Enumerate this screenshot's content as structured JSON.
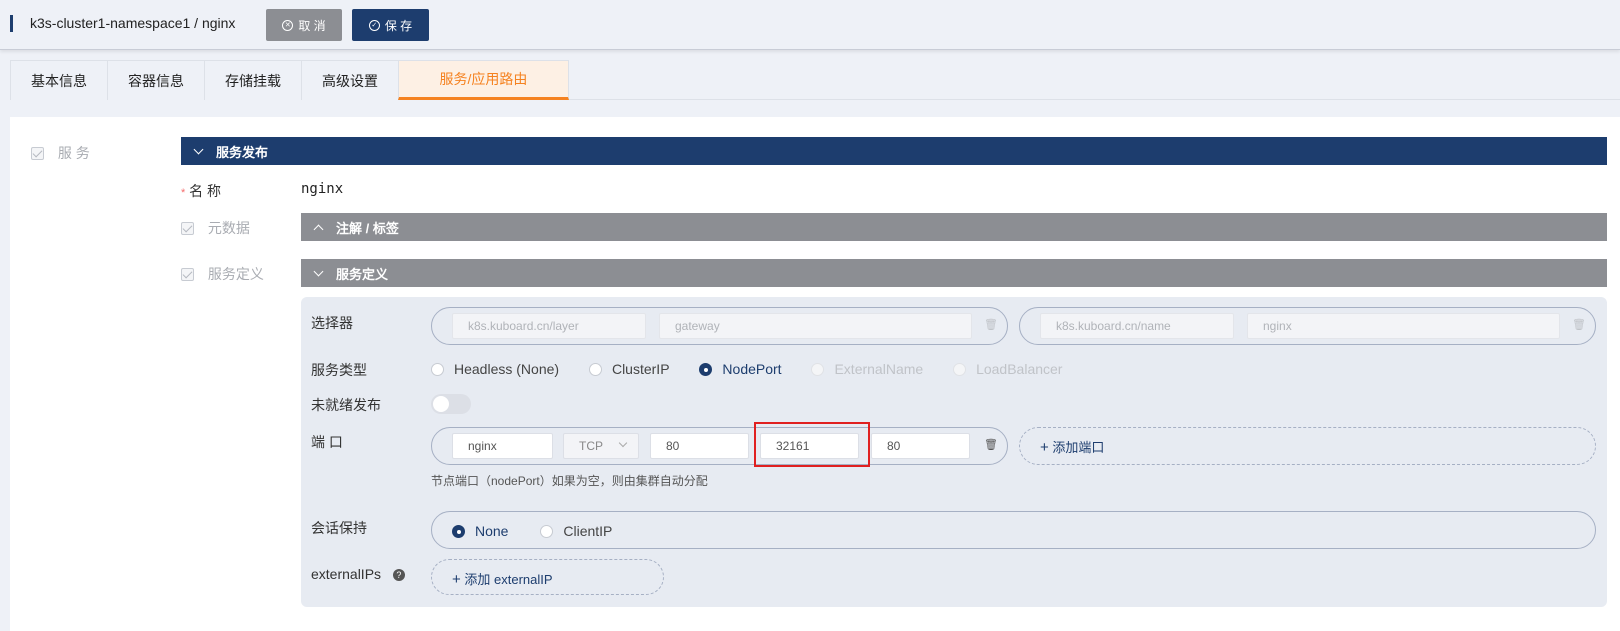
{
  "header": {
    "title": "k3s-cluster1-namespace1 / nginx",
    "cancel_label": "取 消",
    "save_label": "保 存"
  },
  "tabs": [
    {
      "label": "基本信息"
    },
    {
      "label": "容器信息"
    },
    {
      "label": "存储挂载"
    },
    {
      "label": "高级设置"
    },
    {
      "label": "服务/应用路由"
    }
  ],
  "service_checkbox": {
    "label": "服 务"
  },
  "section_publish": {
    "title": "服务发布"
  },
  "name_field": {
    "label": "名 称",
    "value": "nginx",
    "required_mark": "*"
  },
  "metadata": {
    "label": "元数据",
    "section_title": "注解 / 标签"
  },
  "service_def": {
    "label": "服务定义",
    "section_title": "服务定义"
  },
  "selector": {
    "label": "选择器",
    "pairs": [
      {
        "key": "k8s.kuboard.cn/layer",
        "value": "gateway"
      },
      {
        "key": "k8s.kuboard.cn/name",
        "value": "nginx"
      }
    ]
  },
  "service_type": {
    "label": "服务类型",
    "options": [
      {
        "label": "Headless (None)"
      },
      {
        "label": "ClusterIP"
      },
      {
        "label": "NodePort"
      },
      {
        "label": "ExternalName"
      },
      {
        "label": "LoadBalancer"
      }
    ],
    "selected": "NodePort"
  },
  "unready": {
    "label": "未就绪发布",
    "enabled": false
  },
  "ports": {
    "label": "端 口",
    "row": {
      "name": "nginx",
      "protocol": "TCP",
      "port": "80",
      "node_port": "32161",
      "target_port": "80"
    },
    "add_label": "添加端口",
    "hint": "节点端口（nodePort）如果为空，则由集群自动分配"
  },
  "session": {
    "label": "会话保持",
    "options": [
      {
        "label": "None"
      },
      {
        "label": "ClientIP"
      }
    ],
    "selected": "None"
  },
  "external_ips": {
    "label": "externalIPs",
    "help": "?",
    "add_label": "添加 externalIP"
  },
  "icons": {
    "cancel": "x-circle-icon",
    "save": "check-circle-icon",
    "trash": "trash-icon",
    "plus": "plus-icon"
  },
  "colors": {
    "primary": "#1d3d6e",
    "accent": "#f58220",
    "highlight": "#e02020",
    "section_gray": "#8c8e93"
  }
}
